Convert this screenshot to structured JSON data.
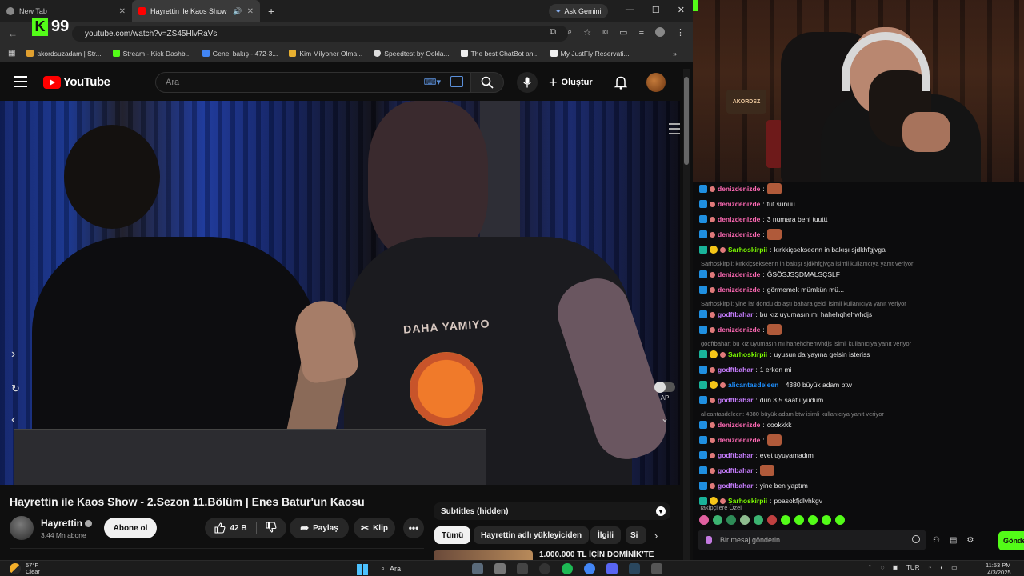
{
  "browser": {
    "tabs": [
      {
        "title": "New Tab",
        "active": false
      },
      {
        "title": "Hayrettin ile Kaos Show - 2",
        "active": true
      }
    ],
    "ask_gemini": "Ask Gemini",
    "url": "youtube.com/watch?v=ZS45HlvRaVs",
    "kick_overlay_count": "99",
    "bookmarks": [
      {
        "label": "akordsuzadam | Str...",
        "color": "#e0a030"
      },
      {
        "label": "Stream - Kick Dashb...",
        "color": "#53fc18"
      },
      {
        "label": "Genel bakış - 472-3...",
        "color": "#4285f4"
      },
      {
        "label": "Kim Milyoner Olma...",
        "color": "#e8b030"
      },
      {
        "label": "Speedtest by Ookla...",
        "color": "#dddddd"
      },
      {
        "label": "The best ChatBot an...",
        "color": "#eeeeee"
      },
      {
        "label": "My JustFly Reservati...",
        "color": "#f0f0f0"
      }
    ]
  },
  "youtube": {
    "logo_text": "YouTube",
    "search_placeholder": "Ara",
    "create_label": "Oluştur",
    "autoplay_label": "AP",
    "video_title": "Hayrettin ile Kaos Show - 2.Sezon 11.Bölüm | Enes Batur'un Kaosu",
    "shirt_text": "DAHA YAMIYO",
    "channel": {
      "name": "Hayrettin",
      "subs": "3,44 Mn abone",
      "subscribe_label": "Abone ol"
    },
    "actions": {
      "likes": "42 B",
      "share": "Paylaş",
      "clip": "Klip",
      "more": "•••"
    },
    "subtitles_panel": "Subtitles (hidden)",
    "chips": [
      "Tümü",
      "Hayrettin adlı yükleyiciden",
      "İlgili",
      "Si"
    ],
    "rec_title": "1.000.000 TL İÇİN DOMİNİK'TE"
  },
  "webcam": {
    "sign_text": "AKORDSZ"
  },
  "chat": {
    "messages": [
      {
        "type": "msg",
        "user": "denizdenizde",
        "color": "#ff69b4",
        "text": "",
        "emote": true,
        "sub": false
      },
      {
        "type": "msg",
        "user": "denizdenizde",
        "color": "#ff69b4",
        "text": "tut sunuu",
        "emote": false,
        "sub": false
      },
      {
        "type": "msg",
        "user": "denizdenizde",
        "color": "#ff69b4",
        "text": "3 numara beni tuuttt",
        "emote": false,
        "sub": false
      },
      {
        "type": "msg",
        "user": "denizdenizde",
        "color": "#ff69b4",
        "text": "",
        "emote": true,
        "sub": false
      },
      {
        "type": "msg",
        "user": "Sarhoskirpii",
        "color": "#7cfc00",
        "text": "kırkkiçsekseenn in bakışı sjdkhfgjvga",
        "emote": false,
        "sub": true
      },
      {
        "type": "reply",
        "text": "Sarhoskirpii: kırkkiçsekseenn in bakışı sjdkhfgjvga isimli kullanıcıya yanıt veriyor"
      },
      {
        "type": "msg",
        "user": "denizdenizde",
        "color": "#ff69b4",
        "text": "ĞSÖSJSŞDMALSÇSLF",
        "emote": false,
        "sub": false
      },
      {
        "type": "msg",
        "user": "denizdenizde",
        "color": "#ff69b4",
        "text": "görmemek mümkün mü...",
        "emote": false,
        "sub": false
      },
      {
        "type": "reply",
        "text": "Sarhoskirpii: yine laf döndü dolaştı bahara geldi isimli kullanıcıya yanıt veriyor"
      },
      {
        "type": "msg",
        "user": "godftbahar",
        "color": "#c77dff",
        "text": "bu kız uyumasın mı hahehqhehwhdjs",
        "emote": false,
        "sub": false
      },
      {
        "type": "msg",
        "user": "denizdenizde",
        "color": "#ff69b4",
        "text": "",
        "emote": true,
        "sub": false
      },
      {
        "type": "reply",
        "text": "godftbahar: bu kız uyumasın mı hahehqhehwhdjs isimli kullanıcıya yanıt veriyor"
      },
      {
        "type": "msg",
        "user": "Sarhoskirpii",
        "color": "#7cfc00",
        "text": "uyusun da yayına gelsin isteriss",
        "emote": false,
        "sub": true
      },
      {
        "type": "msg",
        "user": "godftbahar",
        "color": "#c77dff",
        "text": "1 erken mi",
        "emote": false,
        "sub": false
      },
      {
        "type": "msg",
        "user": "alicantasdeleen",
        "color": "#1e90ff",
        "text": "4380 büyük adam btw",
        "emote": false,
        "sub": true
      },
      {
        "type": "msg",
        "user": "godftbahar",
        "color": "#c77dff",
        "text": "dün 3,5 saat uyudum",
        "emote": false,
        "sub": false
      },
      {
        "type": "reply",
        "text": "alicantasdeleen: 4380 büyük adam btw isimli kullanıcıya yanıt veriyor"
      },
      {
        "type": "msg",
        "user": "denizdenizde",
        "color": "#ff69b4",
        "text": "cookkkk",
        "emote": false,
        "sub": false
      },
      {
        "type": "msg",
        "user": "denizdenizde",
        "color": "#ff69b4",
        "text": "",
        "emote": true,
        "sub": false
      },
      {
        "type": "msg",
        "user": "godftbahar",
        "color": "#c77dff",
        "text": "evet uyuyamadım",
        "emote": false,
        "sub": false
      },
      {
        "type": "msg",
        "user": "godftbahar",
        "color": "#c77dff",
        "text": "",
        "emote": true,
        "sub": false
      },
      {
        "type": "msg",
        "user": "godftbahar",
        "color": "#c77dff",
        "text": "yine ben yaptım",
        "emote": false,
        "sub": false
      },
      {
        "type": "msg",
        "user": "Sarhoskirpii",
        "color": "#7cfc00",
        "text": "poasokfjdlvhkgv",
        "emote": false,
        "sub": true
      }
    ],
    "followers_only_label": "Takipçilere Özel",
    "input_placeholder": "Bir mesaj gönderin",
    "send_label": "Gönder"
  },
  "taskbar": {
    "temp": "57°F",
    "condition": "Clear",
    "search_label": "Ara",
    "lang": "TUR",
    "time": "11:53 PM",
    "date": "4/3/2025"
  }
}
